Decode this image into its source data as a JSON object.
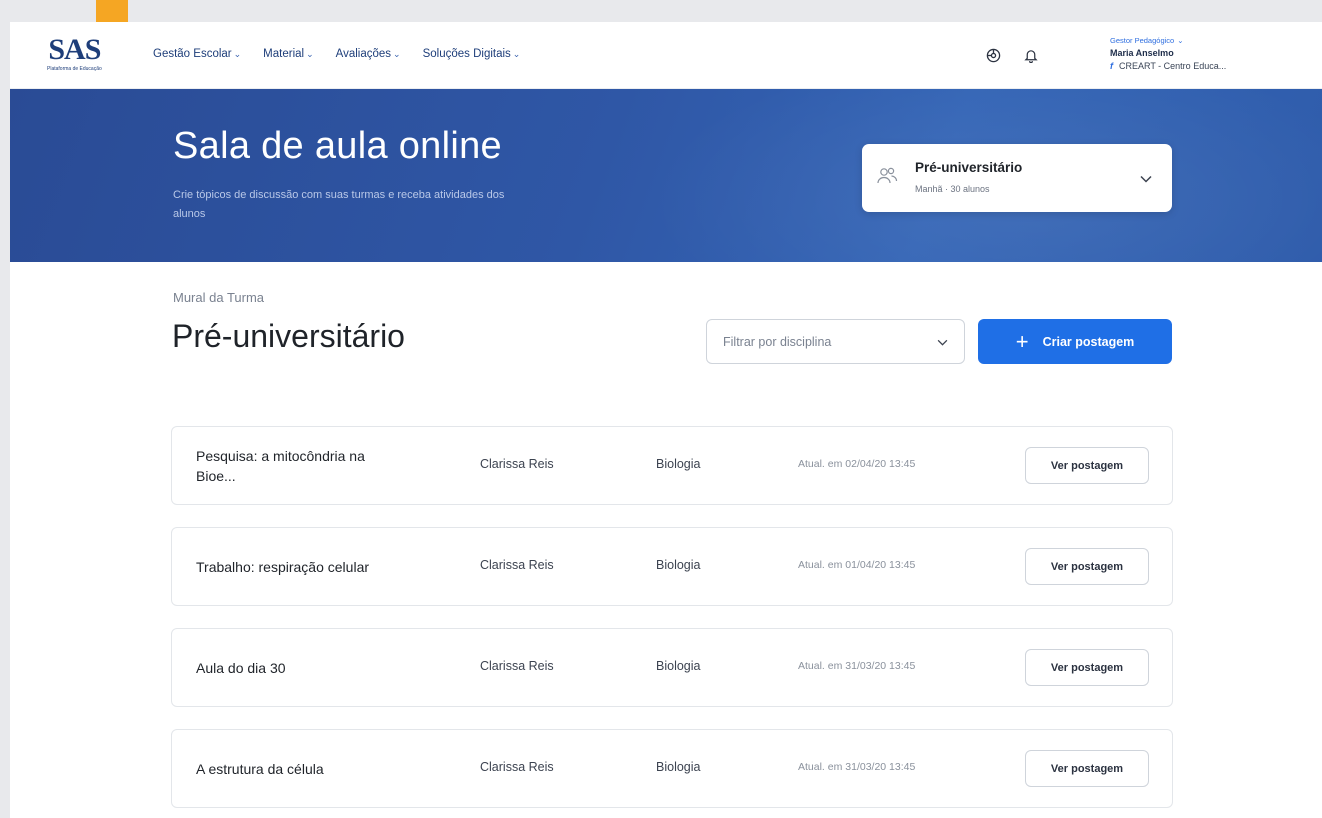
{
  "brand": {
    "logo": "SAS",
    "logo_sub": "Plataforma de Educação"
  },
  "nav": {
    "items": [
      {
        "label": "Gestão Escolar"
      },
      {
        "label": "Material"
      },
      {
        "label": "Avaliações"
      },
      {
        "label": "Soluções Digitais"
      }
    ]
  },
  "user": {
    "role": "Gestor Pedagógico",
    "name": "Maria Anselmo",
    "school": "CREART - Centro Educa..."
  },
  "hero": {
    "title": "Sala de aula online",
    "subtitle": "Crie tópicos de discussão com suas turmas e receba atividades dos alunos"
  },
  "class_selector": {
    "title": "Pré-universitário",
    "subtitle": "Manhã · 30 alunos"
  },
  "mural": {
    "label": "Mural da Turma",
    "title": "Pré-universitário",
    "filter_placeholder": "Filtrar por disciplina",
    "create_label": "Criar postagem"
  },
  "posts": [
    {
      "title": "Pesquisa: a mitocôndria na Bioe...",
      "author": "Clarissa Reis",
      "subject": "Biologia",
      "updated": "Atual. em 02/04/20 13:45",
      "action": "Ver postagem"
    },
    {
      "title": "Trabalho: respiração celular",
      "author": "Clarissa Reis",
      "subject": "Biologia",
      "updated": "Atual. em 01/04/20 13:45",
      "action": "Ver postagem"
    },
    {
      "title": "Aula do dia 30",
      "author": "Clarissa Reis",
      "subject": "Biologia",
      "updated": "Atual. em 31/03/20 13:45",
      "action": "Ver postagem"
    },
    {
      "title": "A estrutura da célula",
      "author": "Clarissa Reis",
      "subject": "Biologia",
      "updated": "Atual. em 31/03/20 13:45",
      "action": "Ver postagem"
    }
  ],
  "colors": {
    "brand": "#1e3e7a",
    "hero": "#2f57a6",
    "primary": "#1f6fe6",
    "accent_tab": "#f5a623"
  }
}
